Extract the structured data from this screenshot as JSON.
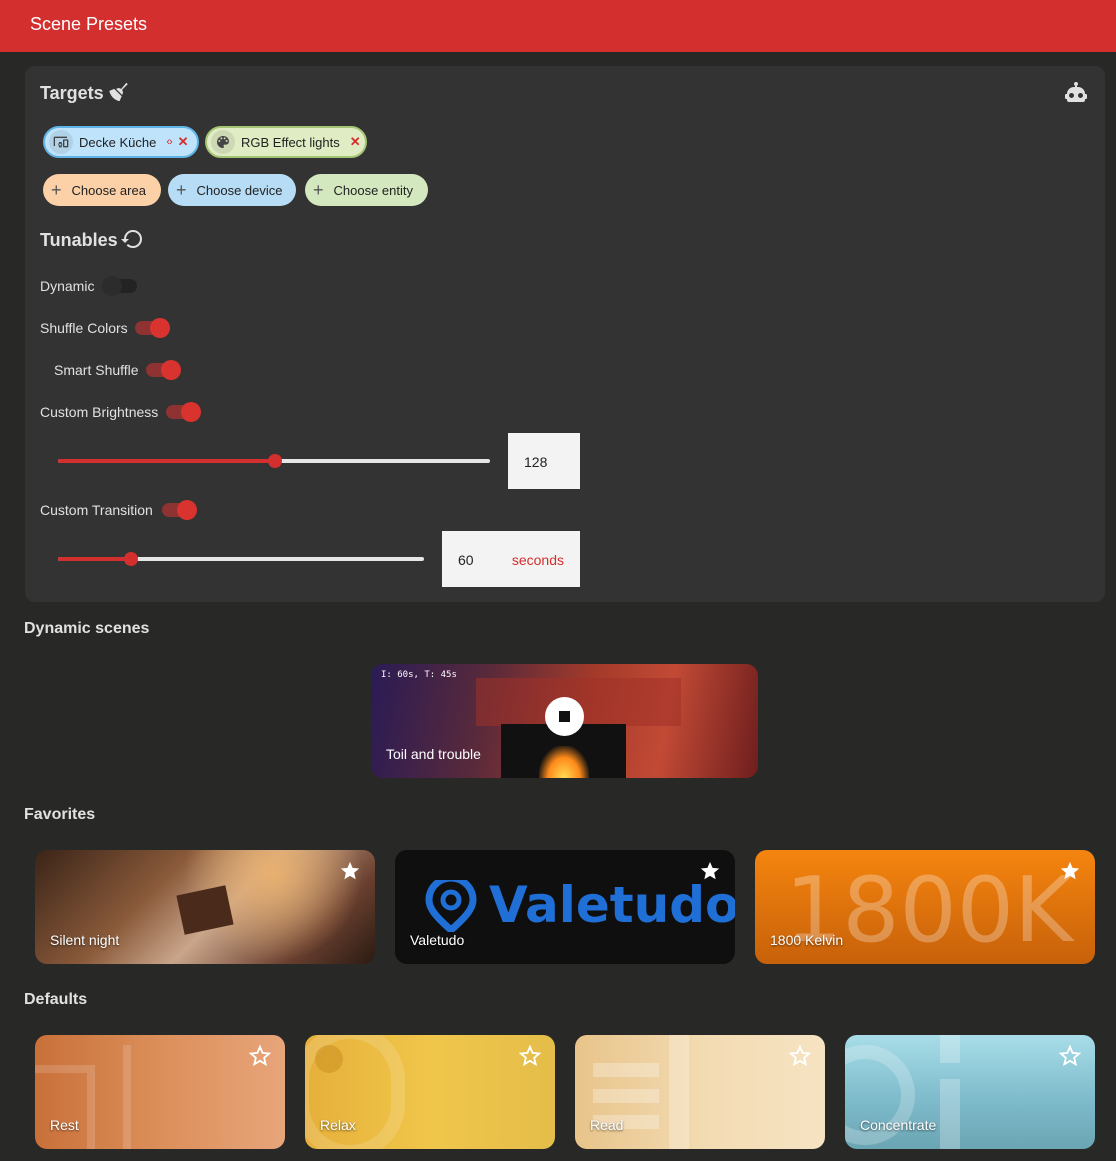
{
  "app": {
    "title": "Scene Presets"
  },
  "targets": {
    "title": "Targets",
    "selected": [
      {
        "label": "Decke Küche",
        "type": "device"
      },
      {
        "label": "RGB Effect lights",
        "type": "entity"
      }
    ],
    "add": {
      "area": "Choose area",
      "device": "Choose device",
      "entity": "Choose entity"
    }
  },
  "tunables": {
    "title": "Tunables",
    "dynamic": {
      "label": "Dynamic",
      "on": false
    },
    "shuffle_colors": {
      "label": "Shuffle Colors",
      "on": true
    },
    "smart_shuffle": {
      "label": "Smart Shuffle",
      "on": true
    },
    "custom_brightness": {
      "label": "Custom Brightness",
      "on": true,
      "value": "128",
      "slider_fraction": 0.502
    },
    "custom_transition": {
      "label": "Custom Transition",
      "on": true,
      "value": "60",
      "unit": "seconds",
      "slider_fraction": 0.2
    }
  },
  "dynamic_scenes": {
    "title": "Dynamic scenes",
    "items": [
      {
        "name": "Toil and trouble",
        "info": "I: 60s, T: 45s",
        "playing": true
      }
    ]
  },
  "favorites": {
    "title": "Favorites",
    "items": [
      {
        "name": "Silent night",
        "starred": true
      },
      {
        "name": "Valetudo",
        "starred": true,
        "logo_text": "Valetudo"
      },
      {
        "name": "1800 Kelvin",
        "starred": true,
        "big_text": "1800K"
      }
    ]
  },
  "defaults": {
    "title": "Defaults",
    "items": [
      {
        "name": "Rest",
        "starred": false
      },
      {
        "name": "Relax",
        "starred": false
      },
      {
        "name": "Read",
        "starred": false
      },
      {
        "name": "Concentrate",
        "starred": false
      }
    ]
  },
  "colors": {
    "accent": "#d32f2f",
    "card": "#333333",
    "background": "#282826"
  },
  "icons": {
    "targets": "broom-icon",
    "automation": "robot-icon",
    "reset": "restore-icon",
    "star": "star-icon",
    "stop": "stop-icon"
  }
}
